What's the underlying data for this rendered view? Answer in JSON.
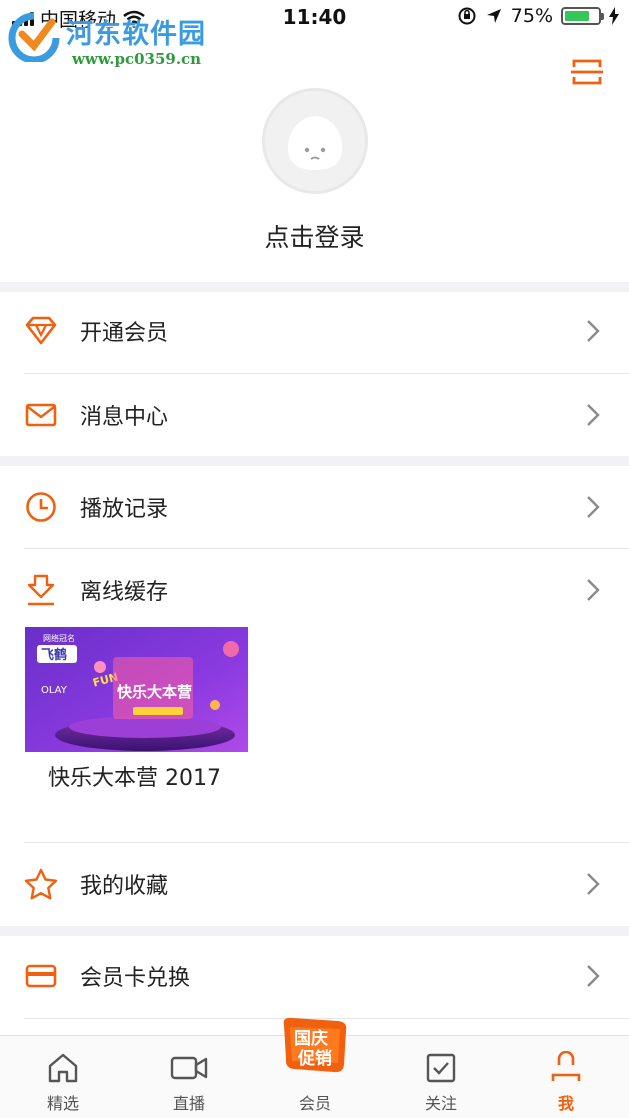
{
  "status_bar": {
    "carrier": "中国移动",
    "time": "11:40",
    "battery": "75%"
  },
  "watermark": {
    "title": "河东软件园",
    "url": "www.pc0359.cn"
  },
  "profile": {
    "login_label": "点击登录"
  },
  "menu": {
    "vip": "开通会员",
    "messages": "消息中心",
    "history": "播放记录",
    "offline": "离线缓存",
    "favorites": "我的收藏",
    "card_redeem": "会员卡兑换"
  },
  "offline_item": {
    "title": "快乐大本营 2017",
    "poster_top": "网络冠名",
    "poster_brand": "飞鹤",
    "poster_sponsor": "OLAY",
    "poster_show": "快乐大本营",
    "poster_fun": "FUN"
  },
  "tabbar": {
    "featured": "精选",
    "live": "直播",
    "vip": "会员",
    "follow": "关注",
    "me": "我",
    "promo_line1": "国庆",
    "promo_line2": "促销"
  },
  "colors": {
    "accent": "#f0600f",
    "gap": "#f2f2f4",
    "text": "#222222"
  },
  "icons": [
    "scan-icon",
    "diamond-icon",
    "mail-icon",
    "clock-icon",
    "download-icon",
    "star-icon",
    "card-icon",
    "home-icon",
    "video-camera-icon",
    "checkbox-icon",
    "user-icon",
    "chevron-right-icon"
  ]
}
